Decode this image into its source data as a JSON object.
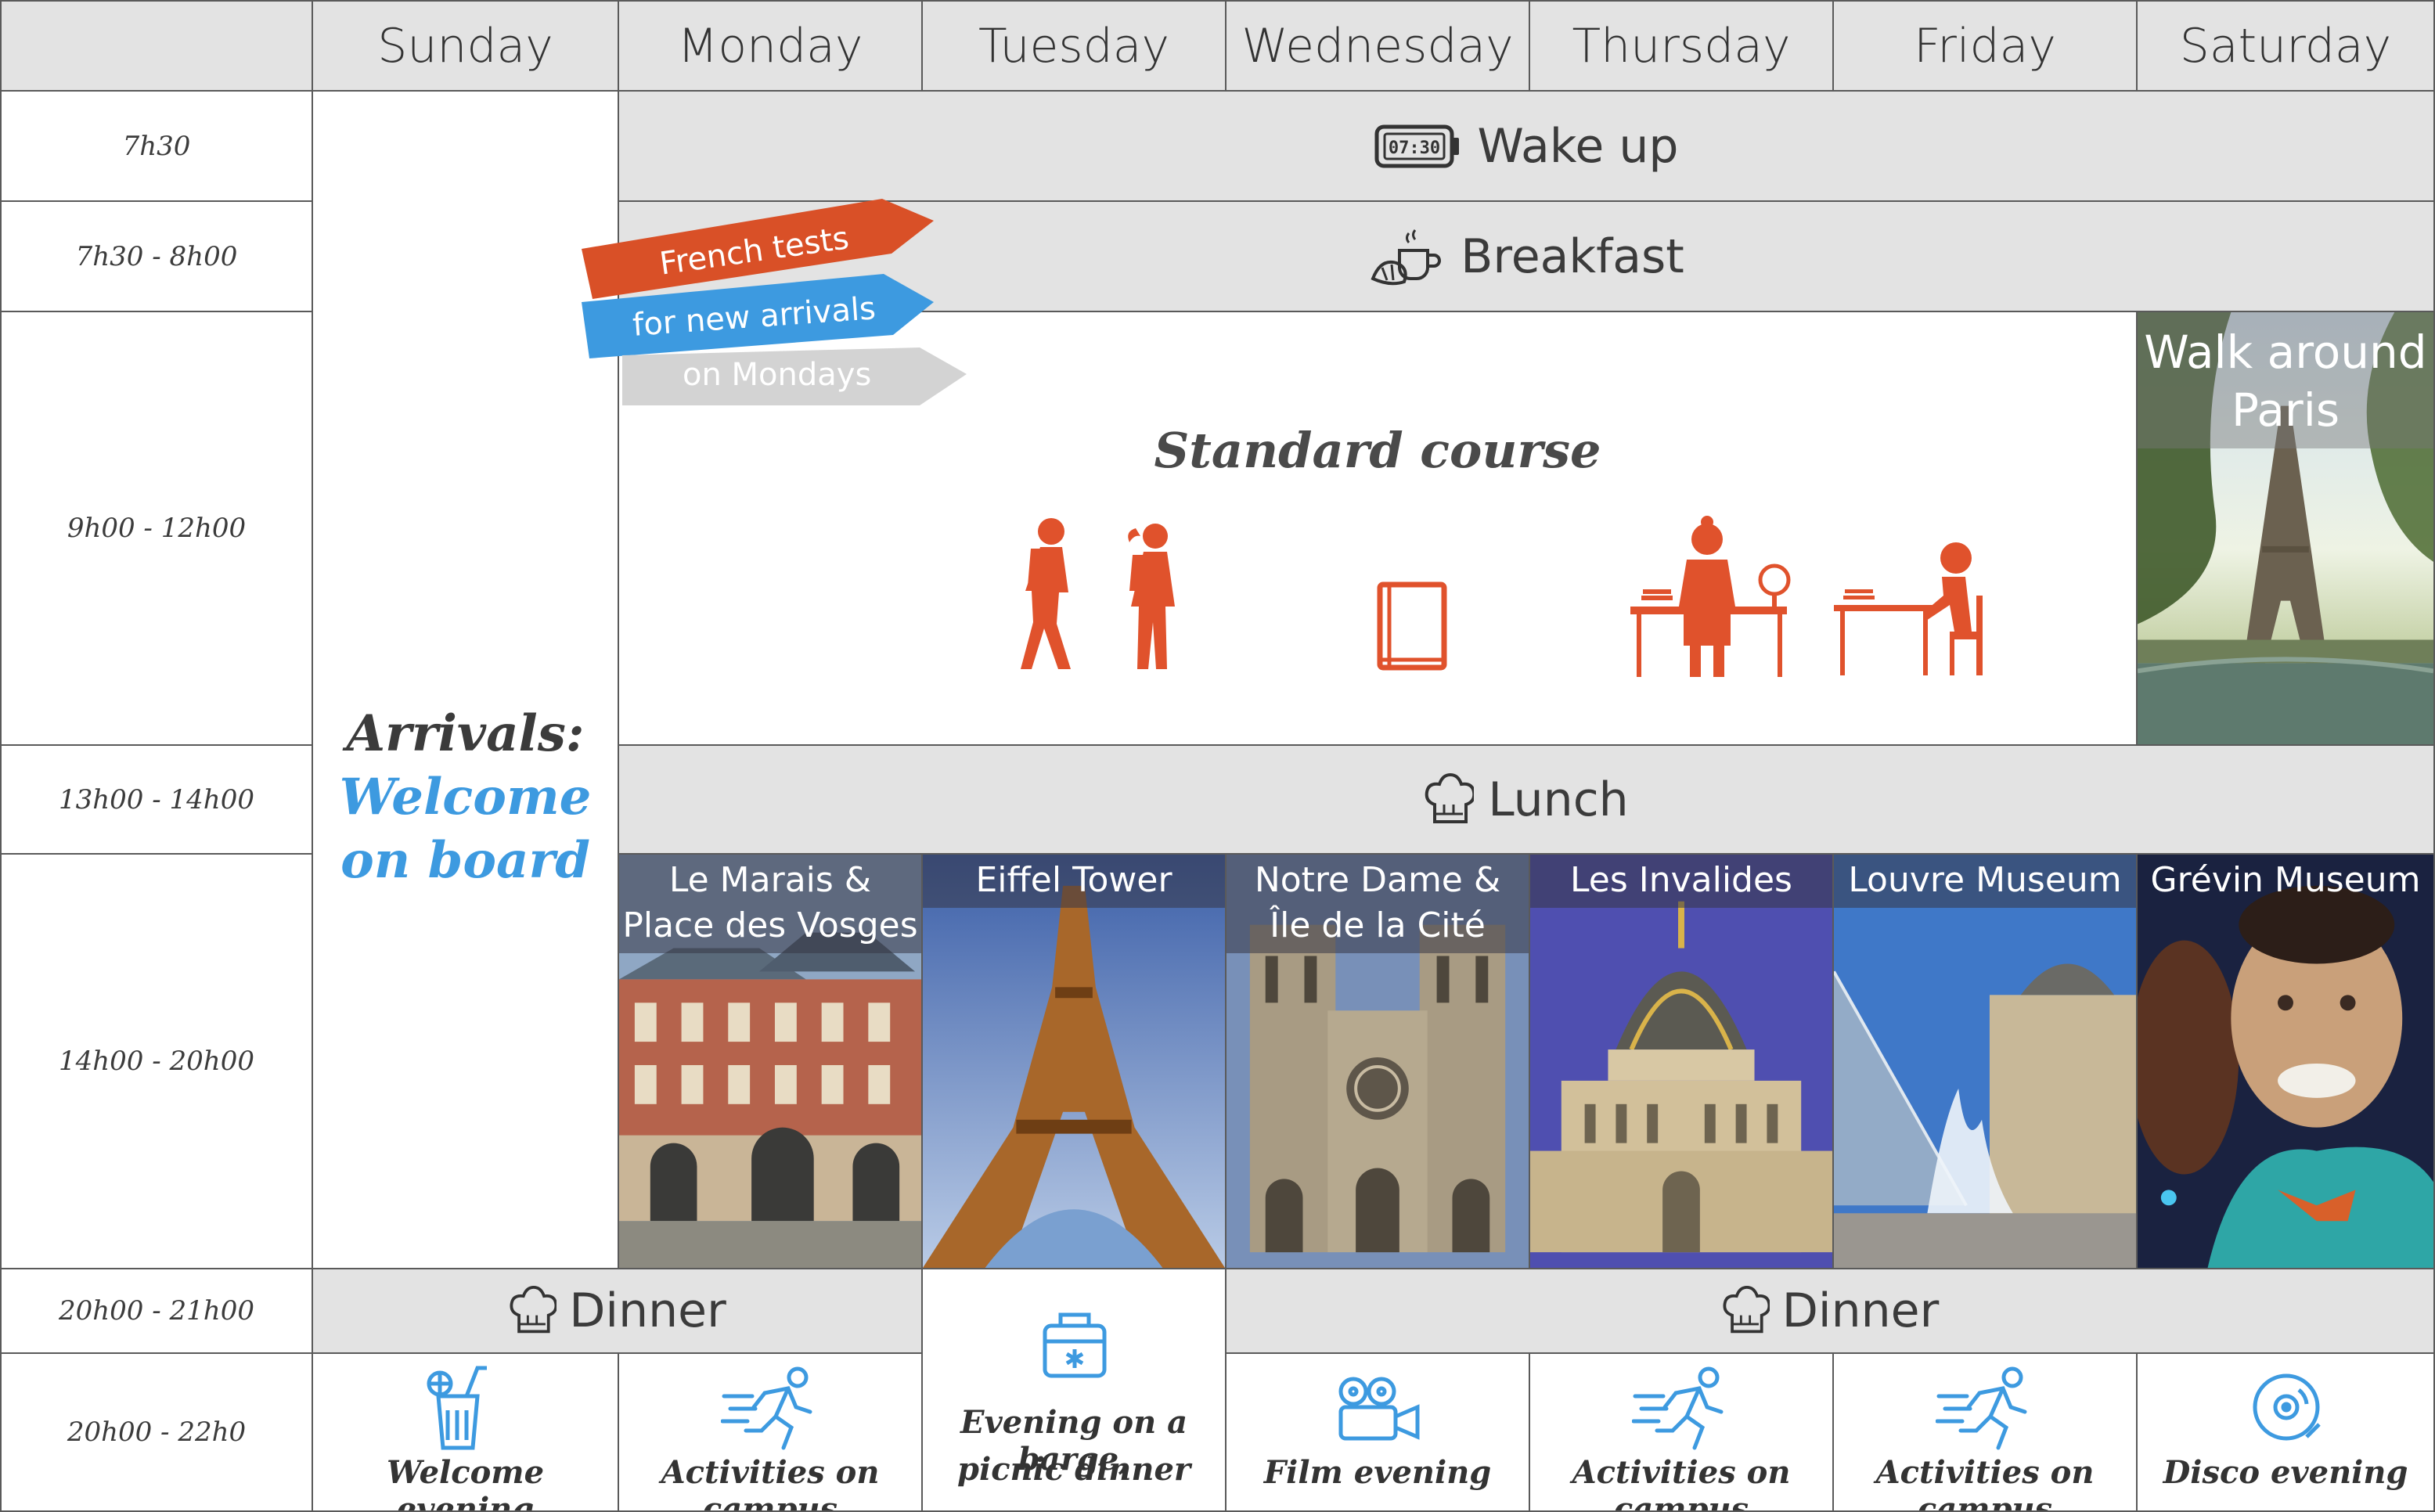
{
  "days": [
    "Sunday",
    "Monday",
    "Tuesday",
    "Wednesday",
    "Thursday",
    "Friday",
    "Saturday"
  ],
  "times": [
    "7h30",
    "7h30 - 8h00",
    "9h00 - 12h00",
    "13h00 - 14h00",
    "14h00 - 20h00",
    "20h00 - 21h00",
    "20h00 - 22h0"
  ],
  "wake_up": {
    "label": "Wake up",
    "clock": "07:30"
  },
  "breakfast": {
    "label": "Breakfast"
  },
  "lunch": {
    "label": "Lunch"
  },
  "dinner": {
    "label": "Dinner"
  },
  "arrivals": {
    "line1": "Arrivals:",
    "line2": "Welcome",
    "line3": "on board"
  },
  "french_tests": {
    "line1": "French tests",
    "line2": "for new arrivals",
    "line3": "on Mondays"
  },
  "standard_course": "Standard course",
  "saturday_morning": {
    "line1": "Walk around",
    "line2": "Paris"
  },
  "visits": [
    {
      "line1": "Le Marais &",
      "line2": "Place des Vosges"
    },
    {
      "line1": "Eiffel Tower",
      "line2": ""
    },
    {
      "line1": "Notre Dame &",
      "line2": "Île de la Cité"
    },
    {
      "line1": "Les Invalides",
      "line2": ""
    },
    {
      "line1": "Louvre Museum",
      "line2": ""
    },
    {
      "line1": "Grévin Museum",
      "line2": ""
    }
  ],
  "evenings": [
    {
      "label": "Welcome evening",
      "icon": "drink-icon"
    },
    {
      "label": "Activities on campus",
      "icon": "running-icon"
    },
    {
      "label1": "Evening on a barge,",
      "label2": "picnic dinner",
      "icon": "cooler-icon"
    },
    {
      "label": "Film evening",
      "icon": "film-camera-icon"
    },
    {
      "label": "Activities on campus",
      "icon": "running-icon"
    },
    {
      "label": "Activities on campus",
      "icon": "running-icon"
    },
    {
      "label": "Disco evening",
      "icon": "vinyl-record-icon"
    }
  ],
  "colors": {
    "orange": "#e0522c",
    "blue": "#3d9ae0",
    "gray_cell": "#e3e3e3",
    "grid_line": "#5a5a5a"
  }
}
